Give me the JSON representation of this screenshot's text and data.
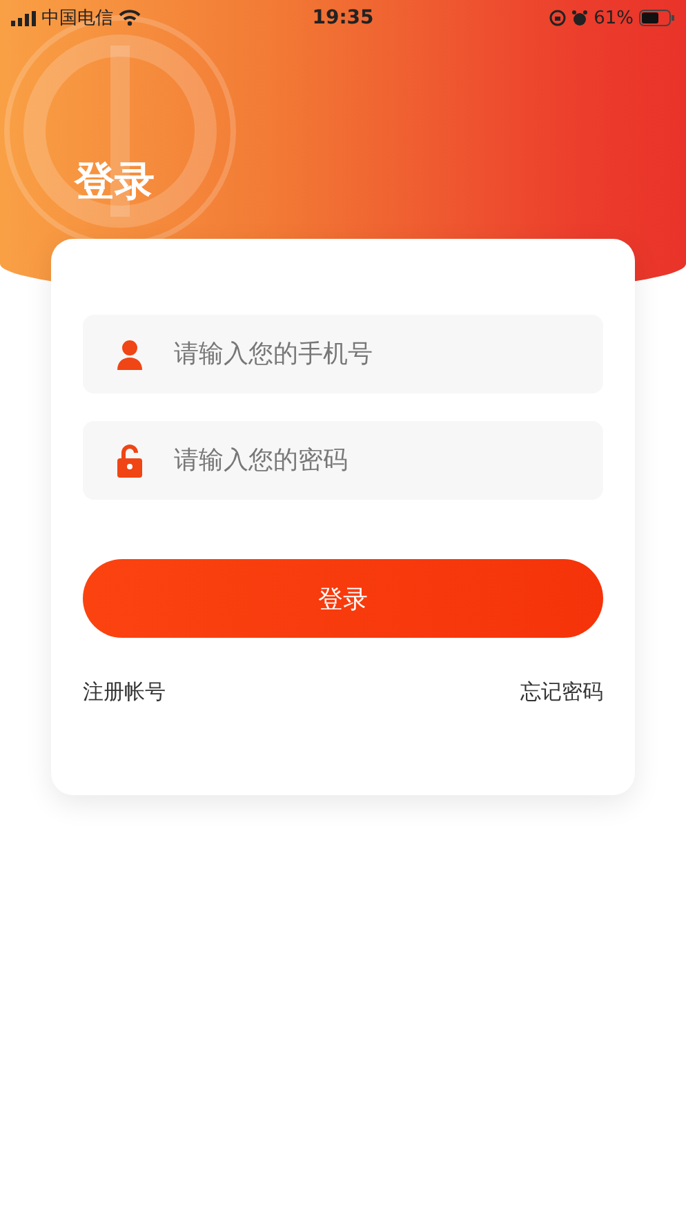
{
  "status_bar": {
    "carrier": "中国电信",
    "time": "19:35",
    "battery": "61%"
  },
  "title": "登录",
  "fields": [
    {
      "kind": "phone",
      "placeholder": "请输入您的手机号"
    },
    {
      "kind": "password",
      "placeholder": "请输入您的密码"
    }
  ],
  "submit_button": "登录",
  "links": [
    {
      "label": "注册帐号"
    },
    {
      "label": "忘记密码"
    }
  ]
}
